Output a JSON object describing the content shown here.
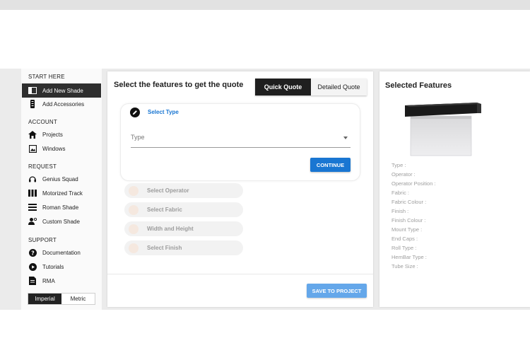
{
  "sidebar": {
    "sections": {
      "start": "START HERE",
      "account": "ACCOUNT",
      "request": "REQUEST",
      "support": "SUPPORT"
    },
    "items": {
      "add_new_shade": "Add New Shade",
      "add_accessories": "Add Accessories",
      "projects": "Projects",
      "windows": "Windows",
      "genius_squad": "Genius Squad",
      "motorized_track": "Motorized Track",
      "roman_shade": "Roman Shade",
      "custom_shade": "Custom Shade",
      "documentation": "Documentation",
      "tutorials": "Tutorials",
      "rma": "RMA"
    },
    "units": {
      "imperial": "Imperial",
      "metric": "Metric",
      "selected": "Imperial"
    }
  },
  "main": {
    "title": "Select the features to get the quote",
    "quote_toggle": {
      "quick": "Quick Quote",
      "detailed": "Detailed Quote",
      "selected": "Quick Quote"
    },
    "current_step": {
      "title": "Select Type",
      "icon": "pencil-icon",
      "select_placeholder": "Type",
      "continue_label": "CONTINUE"
    },
    "pending_steps": [
      "Select Operator",
      "Select Fabric",
      "Width and Height",
      "Select Finish"
    ],
    "save_label": "SAVE TO PROJECT"
  },
  "features": {
    "title": "Selected Features",
    "image": "roller-shade-preview",
    "list": [
      "Type :",
      "Operator :",
      "Operator Position :",
      "Fabric :",
      "Fabric Colour :",
      "Finish :",
      "Finish Colour :",
      "Mount Type :",
      "End Caps :",
      "Roll Type :",
      "HemBar Type :",
      "Tube Size :"
    ]
  },
  "colors": {
    "accent": "#1976d2",
    "save_button": "#64a7ea",
    "dark": "#1f1f1f",
    "sidebar_active": "#2f2f2f"
  }
}
